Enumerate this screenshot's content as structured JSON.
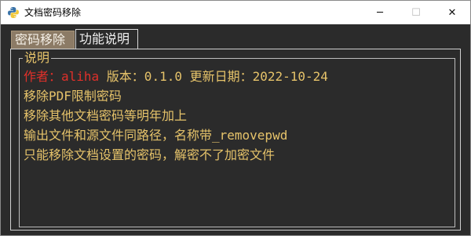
{
  "window": {
    "title": "文档密码移除",
    "controls": {
      "minimize": "─",
      "maximize": "☐",
      "close": "✕"
    }
  },
  "tabs": [
    {
      "label": "密码移除",
      "selected": false
    },
    {
      "label": "功能说明",
      "selected": true
    }
  ],
  "panel": {
    "group_label": "说明",
    "author": "作者：aliha",
    "version_date": " 版本：0.1.0 更新日期：2022-10-24",
    "lines": [
      "移除PDF限制密码",
      "移除其他文档密码等明年加上",
      "输出文件和源文件同路径，名称带_removepwd",
      "只能移除文档设置的密码，解密不了加密文件"
    ]
  },
  "colors": {
    "background": "#2b2b2b",
    "text": "#e6c36a",
    "author": "#e0302a",
    "inactive_tab": "#8c7b66"
  },
  "icons": {
    "app": "python-logo-icon"
  }
}
